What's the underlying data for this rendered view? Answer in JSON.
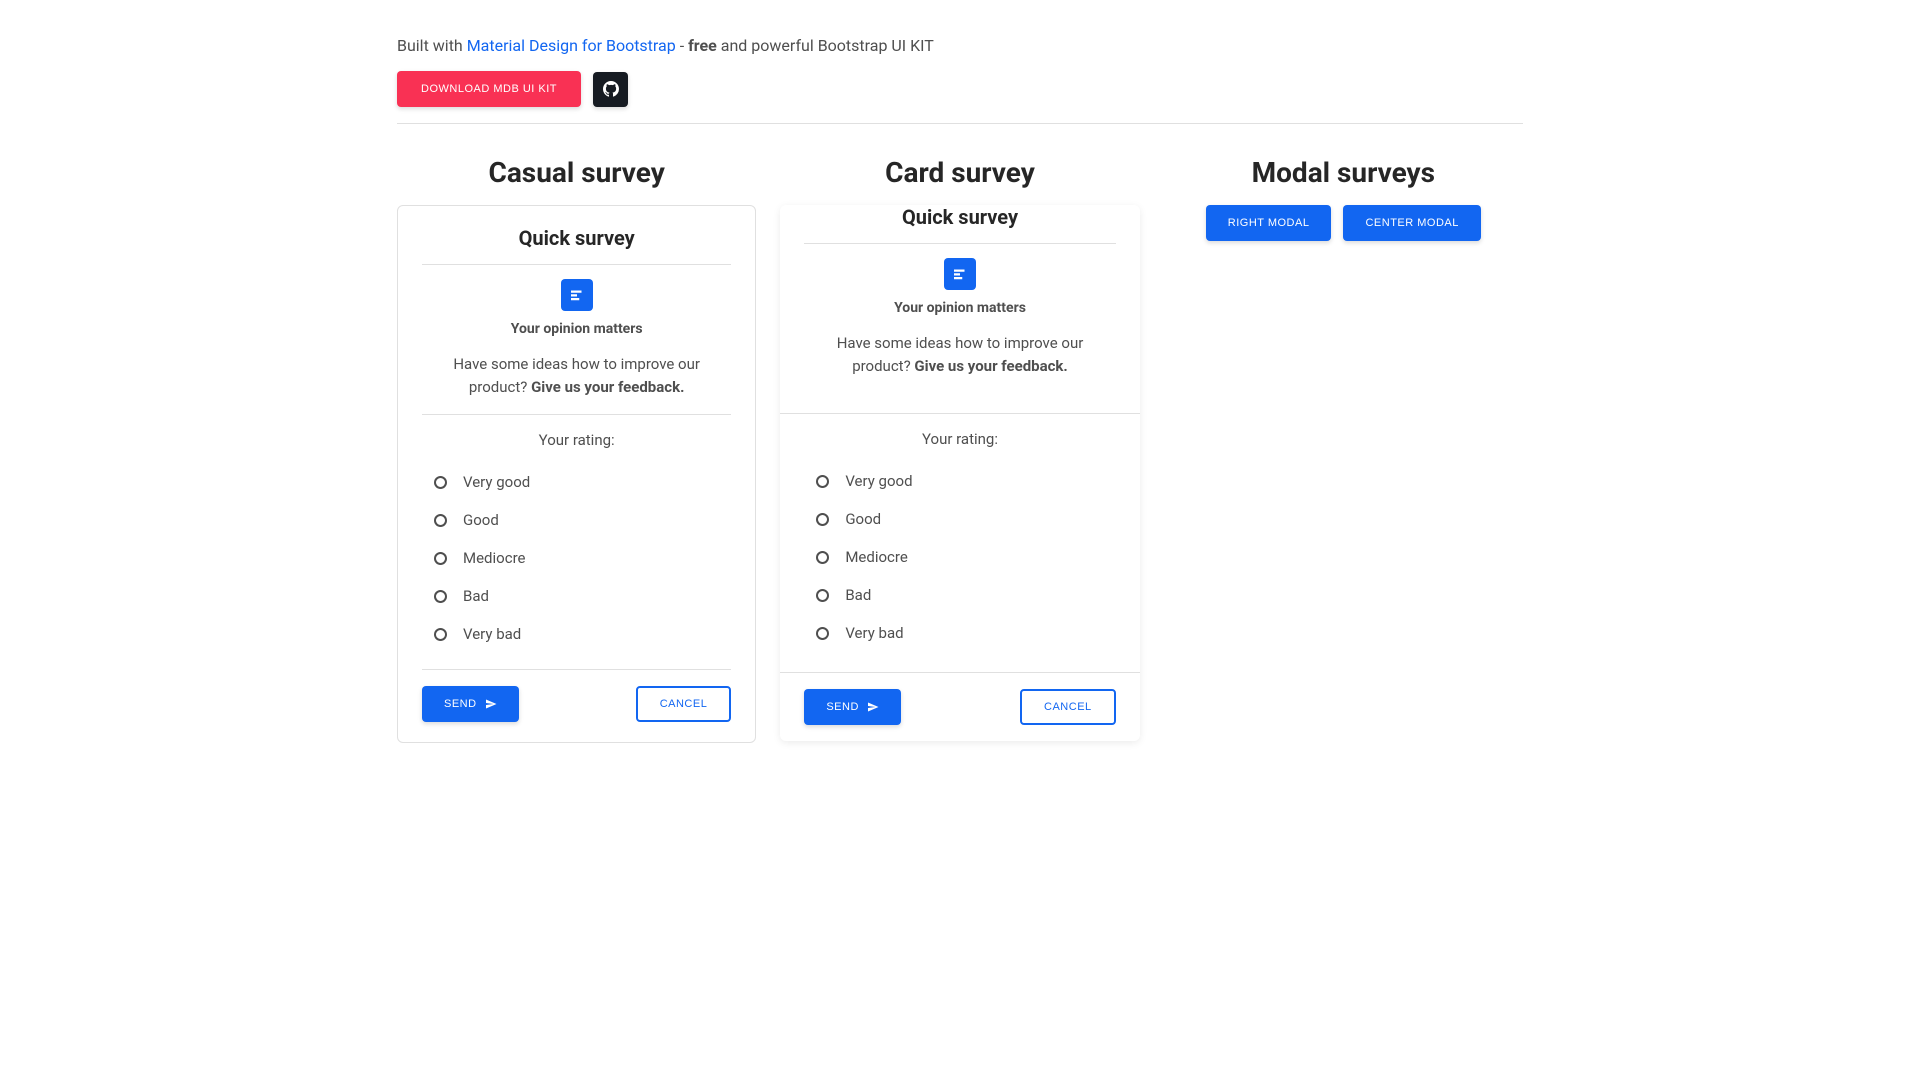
{
  "topbar": {
    "built_with": "Built with ",
    "mdb_link": "Material Design for Bootstrap",
    "dash": " - ",
    "free": "free",
    "rest": " and powerful Bootstrap UI KIT",
    "download_btn": "Download MDB UI KIT"
  },
  "sections": {
    "casual": "Casual survey",
    "card": "Card survey",
    "modal": "Modal surveys"
  },
  "survey": {
    "title": "Quick survey",
    "opinion": "Your opinion matters",
    "prompt_text": "Have some ideas how to improve our product? ",
    "prompt_bold": "Give us your feedback.",
    "rating_label": "Your rating:",
    "options": {
      "o0": "Very good",
      "o1": "Good",
      "o2": "Mediocre",
      "o3": "Bad",
      "o4": "Very bad"
    },
    "send": "Send",
    "cancel": "Cancel"
  },
  "modal": {
    "right": "Right Modal",
    "center": "Center Modal"
  }
}
